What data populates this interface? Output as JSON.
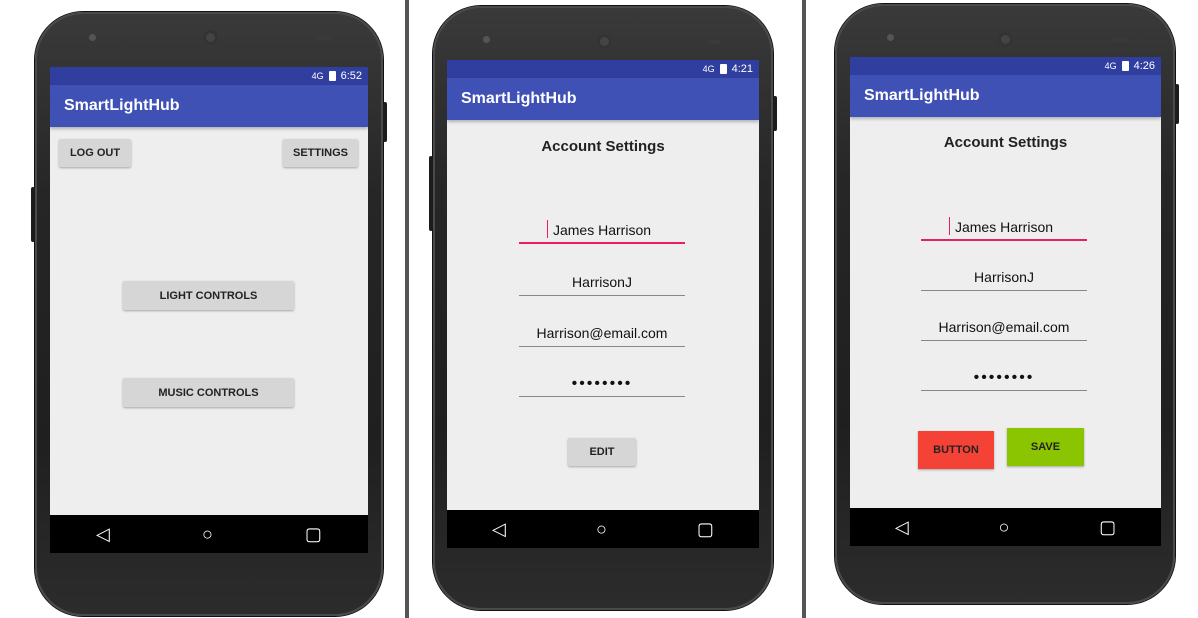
{
  "status": {
    "network_label": "4G",
    "screens": [
      "6:52",
      "4:21",
      "4:26"
    ]
  },
  "app_title": "SmartLightHub",
  "nav_icons": [
    "back-icon",
    "home-icon",
    "recents-icon"
  ],
  "nav_glyphs": {
    "back": "◁",
    "home": "○",
    "recents": "▢"
  },
  "home_screen": {
    "logout_label": "LOG OUT",
    "settings_label": "SETTINGS",
    "light_controls_label": "LIGHT CONTROLS",
    "music_controls_label": "MUSIC CONTROLS"
  },
  "account_screen": {
    "title": "Account Settings",
    "fields": {
      "full_name": "James Harrison",
      "username": "HarrisonJ",
      "email": "Harrison@email.com",
      "password": "••••••••"
    },
    "edit_label": "EDIT",
    "button_label": "BUTTON",
    "save_label": "SAVE"
  },
  "colors": {
    "status_bar": "#303f9f",
    "app_bar": "#3f51b5",
    "accent_underline": "#e91e63",
    "red_button": "#f44336",
    "green_button": "#8bc400"
  }
}
